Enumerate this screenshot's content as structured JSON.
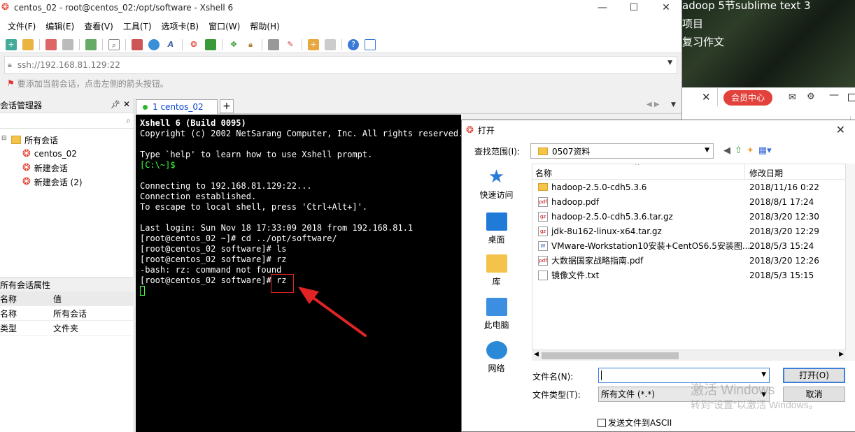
{
  "background": {
    "top_lines": [
      "adoop 5节sublime text 3",
      "项目",
      "复习作文"
    ],
    "vip_button": "会员中心"
  },
  "xshell": {
    "window_title": "centos_02 - root@centos_02:/opt/software - Xshell 6",
    "menu": [
      "文件(F)",
      "编辑(E)",
      "查看(V)",
      "工具(T)",
      "选项卡(B)",
      "窗口(W)",
      "帮助(H)"
    ],
    "address": "ssh://192.168.81.129:22",
    "hint": "要添加当前会话，点击左侧的箭头按钮。",
    "session_manager": {
      "title": "会话管理器",
      "root": "所有会话",
      "items": [
        "centos_02",
        "新建会话",
        "新建会话 (2)"
      ]
    },
    "properties": {
      "title": "所有会话属性",
      "header": [
        "名称",
        "值"
      ],
      "rows": [
        [
          "名称",
          "所有会话"
        ],
        [
          "类型",
          "文件夹"
        ]
      ]
    },
    "tab": {
      "label": "1 centos_02"
    },
    "terminal": {
      "lines": [
        {
          "text": "Xshell 6 (Build 0095)",
          "style": "bold"
        },
        {
          "text": "Copyright (c) 2002 NetSarang Computer, Inc. All rights reserved.",
          "style": ""
        },
        {
          "text": "",
          "style": ""
        },
        {
          "text": "Type `help' to learn how to use Xshell prompt.",
          "style": ""
        },
        {
          "text": "[C:\\~]$",
          "style": "green"
        },
        {
          "text": "",
          "style": ""
        },
        {
          "text": "Connecting to 192.168.81.129:22...",
          "style": ""
        },
        {
          "text": "Connection established.",
          "style": ""
        },
        {
          "text": "To escape to local shell, press 'Ctrl+Alt+]'.",
          "style": ""
        },
        {
          "text": "",
          "style": ""
        },
        {
          "text": "Last login: Sun Nov 18 17:33:09 2018 from 192.168.81.1",
          "style": ""
        },
        {
          "text": "[root@centos_02 ~]# cd ../opt/software/",
          "style": ""
        },
        {
          "text": "[root@centos_02 software]# ls",
          "style": ""
        },
        {
          "text": "[root@centos_02 software]# rz",
          "style": ""
        },
        {
          "text": "-bash: rz: command not found",
          "style": ""
        },
        {
          "text": "[root@centos_02 software]# rz",
          "style": ""
        }
      ]
    }
  },
  "dialog": {
    "title": "打开",
    "look_in_label": "查找范围(I):",
    "look_in_value": "0507资料",
    "places": [
      "快速访问",
      "桌面",
      "库",
      "此电脑",
      "网络"
    ],
    "columns": [
      "名称",
      "修改日期"
    ],
    "files": [
      {
        "name": "hadoop-2.5.0-cdh5.3.6",
        "date": "2018/11/16 0:22",
        "kind": "folder"
      },
      {
        "name": "hadoop.pdf",
        "date": "2018/8/1 17:24",
        "kind": "pdf"
      },
      {
        "name": "hadoop-2.5.0-cdh5.3.6.tar.gz",
        "date": "2018/3/20 12:30",
        "kind": "gz"
      },
      {
        "name": "jdk-8u162-linux-x64.tar.gz",
        "date": "2018/3/20 12:29",
        "kind": "gz"
      },
      {
        "name": "VMware-Workstation10安装+CentOS6.5安装图...",
        "date": "2018/5/3 15:24",
        "kind": "doc"
      },
      {
        "name": "大数据国家战略指南.pdf",
        "date": "2018/3/20 12:26",
        "kind": "pdf"
      },
      {
        "name": "镜像文件.txt",
        "date": "2018/5/3 15:15",
        "kind": "txt"
      }
    ],
    "filename_label": "文件名(N):",
    "filename_value": "",
    "filetype_label": "文件类型(T):",
    "filetype_value": "所有文件 (*.*)",
    "open_button": "打开(O)",
    "cancel_button": "取消",
    "ascii_checkbox": "发送文件到ASCII",
    "watermark_line1": "激活 Windows",
    "watermark_line2": "转到\"设置\"以激活 Windows。"
  }
}
